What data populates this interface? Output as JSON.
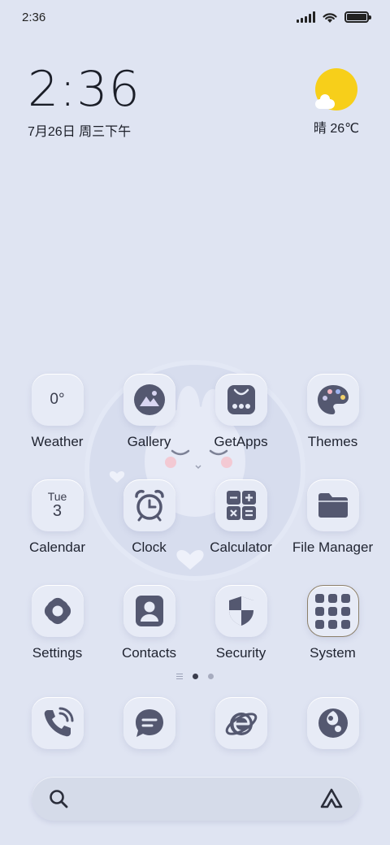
{
  "status_bar": {
    "time": "2:36"
  },
  "clock_widget": {
    "time": "2:36",
    "date": "7月26日 周三下午"
  },
  "weather_widget": {
    "condition": "晴",
    "temperature": "26℃"
  },
  "apps": [
    [
      {
        "label": "Weather",
        "icon": "weather-icon",
        "tile_text": "0°"
      },
      {
        "label": "Gallery",
        "icon": "gallery-icon"
      },
      {
        "label": "GetApps",
        "icon": "getapps-icon"
      },
      {
        "label": "Themes",
        "icon": "palette-icon"
      }
    ],
    [
      {
        "label": "Calendar",
        "icon": "calendar-icon",
        "day": "Tue",
        "date": "3"
      },
      {
        "label": "Clock",
        "icon": "alarm-clock-icon"
      },
      {
        "label": "Calculator",
        "icon": "calculator-icon"
      },
      {
        "label": "File Manager",
        "icon": "folder-icon"
      }
    ],
    [
      {
        "label": "Settings",
        "icon": "settings-icon"
      },
      {
        "label": "Contacts",
        "icon": "contacts-icon"
      },
      {
        "label": "Security",
        "icon": "shield-icon"
      },
      {
        "label": "System",
        "icon": "folder-grid-icon"
      }
    ]
  ],
  "dock": [
    {
      "icon": "phone-icon"
    },
    {
      "icon": "message-icon"
    },
    {
      "icon": "browser-icon"
    },
    {
      "icon": "camera-icon"
    }
  ],
  "page_indicator": {
    "pages": 2,
    "current": 1
  },
  "colors": {
    "background": "#dfe4f2",
    "icon_glyph": "#545870",
    "sun": "#f7cf1a"
  }
}
